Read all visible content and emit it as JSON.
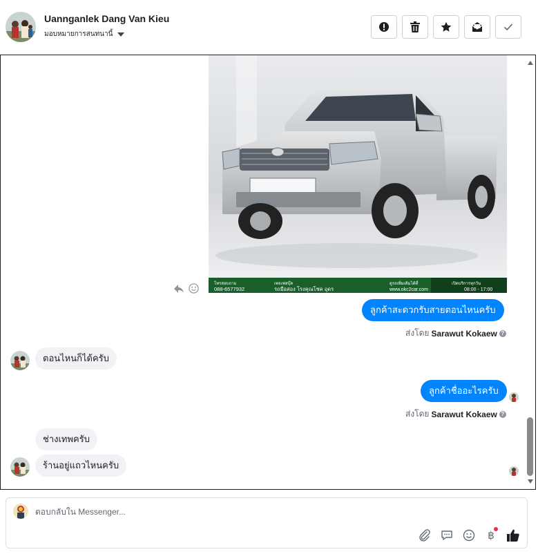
{
  "header": {
    "contact_name": "Uannganlek Dang Van Kieu",
    "assign_label": "มอบหมายการสนทนานี้",
    "actions": [
      {
        "name": "spam-button",
        "icon": "exclamation-icon"
      },
      {
        "name": "delete-button",
        "icon": "trash-icon"
      },
      {
        "name": "star-button",
        "icon": "star-icon"
      },
      {
        "name": "mark-unread-button",
        "icon": "envelope-icon"
      },
      {
        "name": "mark-done-button",
        "icon": "check-icon"
      }
    ]
  },
  "photo": {
    "banner_left_phone": "088-6577932",
    "banner_mid_text": "รถมือสอง โรงคุณโชค อุดร",
    "banner_right_url": "www.okc2car.com",
    "banner_hours": "08:00 - 17:00"
  },
  "messages": {
    "out_1": "ลูกค้าสะดวกรับสายตอนไหนครับ",
    "in_1": "ตอนไหนก็ได้ครับ",
    "out_2": "ลูกค้าชื่ออะไรครับ",
    "in_2": "ช่างเทพครับ",
    "in_3": "ร้านอยู่แถวไหนครับ"
  },
  "sent_by": {
    "prefix": "ส่งโดย",
    "agent_name": "Sarawut Kokaew"
  },
  "composer": {
    "placeholder": "ตอบกลับใน Messenger..."
  },
  "colors": {
    "outgoing_bubble": "#0084ff",
    "incoming_bubble": "#f0f2f5",
    "notification_dot": "#f02849"
  }
}
